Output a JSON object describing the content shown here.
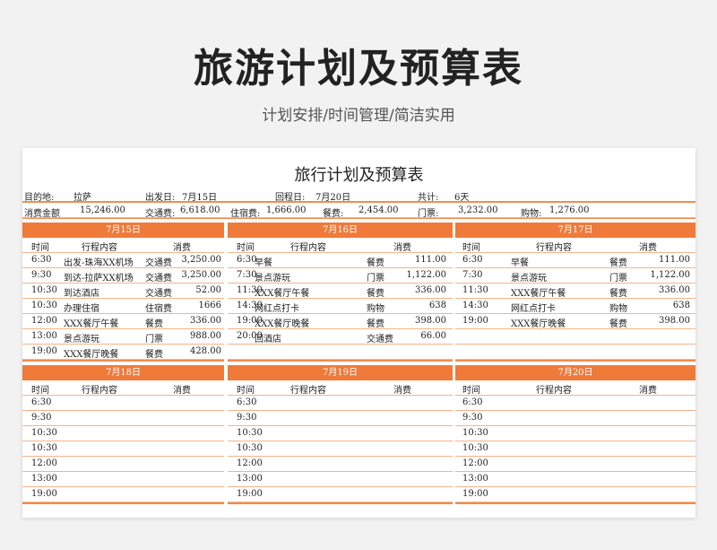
{
  "header": {
    "title": "旅游计划及预算表",
    "subtitle": "计划安排/时间管理/简洁实用"
  },
  "sheet": {
    "title": "旅行计划及预算表",
    "info": {
      "destination_label": "目的地:",
      "destination": "拉萨",
      "depart_label": "出发日:",
      "depart": "7月15日",
      "return_label": "回程日:",
      "return": "7月20日",
      "total_label": "共计:",
      "total": "6天"
    },
    "budget": {
      "total_label": "消费金额",
      "total": "15,246.00",
      "transport_label": "交通费:",
      "transport": "6,618.00",
      "lodging_label": "住宿费:",
      "lodging": "1,666.00",
      "meals_label": "餐费:",
      "meals": "2,454.00",
      "tickets_label": "门票:",
      "tickets": "3,232.00",
      "shopping_label": "购物:",
      "shopping": "1,276.00"
    },
    "columns": {
      "time": "时间",
      "item": "行程内容",
      "cost": "消费"
    },
    "days": [
      {
        "date": "7月15日",
        "rows": [
          {
            "time": "6:30",
            "item": "出发-珠海XX机场",
            "cat": "交通费",
            "amount": "3,250.00"
          },
          {
            "time": "9:30",
            "item": "到达-拉萨XX机场",
            "cat": "交通费",
            "amount": "3,250.00"
          },
          {
            "time": "10:30",
            "item": "到达酒店",
            "cat": "交通费",
            "amount": "52.00"
          },
          {
            "time": "10:30",
            "item": "办理住宿",
            "cat": "住宿费",
            "amount": "1666"
          },
          {
            "time": "12:00",
            "item": "XXX餐厅午餐",
            "cat": "餐费",
            "amount": "336.00"
          },
          {
            "time": "13:00",
            "item": "景点游玩",
            "cat": "门票",
            "amount": "988.00"
          },
          {
            "time": "19:00",
            "item": "XXX餐厅晚餐",
            "cat": "餐费",
            "amount": "428.00"
          }
        ]
      },
      {
        "date": "7月16日",
        "rows": [
          {
            "time": "6:30",
            "item": "早餐",
            "cat": "餐费",
            "amount": "111.00"
          },
          {
            "time": "7:30",
            "item": "景点游玩",
            "cat": "门票",
            "amount": "1,122.00"
          },
          {
            "time": "11:30",
            "item": "XXX餐厅午餐",
            "cat": "餐费",
            "amount": "336.00"
          },
          {
            "time": "14:30",
            "item": "网红点打卡",
            "cat": "购物",
            "amount": "638"
          },
          {
            "time": "19:00",
            "item": "XXX餐厅晚餐",
            "cat": "餐费",
            "amount": "398.00"
          },
          {
            "time": "20:00",
            "item": "回酒店",
            "cat": "交通费",
            "amount": "66.00"
          },
          {
            "time": "",
            "item": "",
            "cat": "",
            "amount": ""
          }
        ]
      },
      {
        "date": "7月17日",
        "rows": [
          {
            "time": "6:30",
            "item": "早餐",
            "cat": "餐费",
            "amount": "111.00"
          },
          {
            "time": "7:30",
            "item": "景点游玩",
            "cat": "门票",
            "amount": "1,122.00"
          },
          {
            "time": "11:30",
            "item": "XXX餐厅午餐",
            "cat": "餐费",
            "amount": "336.00"
          },
          {
            "time": "14:30",
            "item": "网红点打卡",
            "cat": "购物",
            "amount": "638"
          },
          {
            "time": "19:00",
            "item": "XXX餐厅晚餐",
            "cat": "餐费",
            "amount": "398.00"
          },
          {
            "time": "",
            "item": "",
            "cat": "",
            "amount": ""
          },
          {
            "time": "",
            "item": "",
            "cat": "",
            "amount": ""
          }
        ]
      },
      {
        "date": "7月18日",
        "rows": [
          {
            "time": "6:30",
            "item": "",
            "cat": "",
            "amount": ""
          },
          {
            "time": "9:30",
            "item": "",
            "cat": "",
            "amount": ""
          },
          {
            "time": "10:30",
            "item": "",
            "cat": "",
            "amount": ""
          },
          {
            "time": "10:30",
            "item": "",
            "cat": "",
            "amount": ""
          },
          {
            "time": "12:00",
            "item": "",
            "cat": "",
            "amount": ""
          },
          {
            "time": "13:00",
            "item": "",
            "cat": "",
            "amount": ""
          },
          {
            "time": "19:00",
            "item": "",
            "cat": "",
            "amount": ""
          }
        ]
      },
      {
        "date": "7月19日",
        "rows": [
          {
            "time": "6:30",
            "item": "",
            "cat": "",
            "amount": ""
          },
          {
            "time": "9:30",
            "item": "",
            "cat": "",
            "amount": ""
          },
          {
            "time": "10:30",
            "item": "",
            "cat": "",
            "amount": ""
          },
          {
            "time": "10:30",
            "item": "",
            "cat": "",
            "amount": ""
          },
          {
            "time": "12:00",
            "item": "",
            "cat": "",
            "amount": ""
          },
          {
            "time": "13:00",
            "item": "",
            "cat": "",
            "amount": ""
          },
          {
            "time": "19:00",
            "item": "",
            "cat": "",
            "amount": ""
          }
        ]
      },
      {
        "date": "7月20日",
        "rows": [
          {
            "time": "6:30",
            "item": "",
            "cat": "",
            "amount": ""
          },
          {
            "time": "9:30",
            "item": "",
            "cat": "",
            "amount": ""
          },
          {
            "time": "10:30",
            "item": "",
            "cat": "",
            "amount": ""
          },
          {
            "time": "10:30",
            "item": "",
            "cat": "",
            "amount": ""
          },
          {
            "time": "12:00",
            "item": "",
            "cat": "",
            "amount": ""
          },
          {
            "time": "13:00",
            "item": "",
            "cat": "",
            "amount": ""
          },
          {
            "time": "19:00",
            "item": "",
            "cat": "",
            "amount": ""
          }
        ]
      }
    ]
  },
  "colors": {
    "accent": "#f07a3a",
    "rule": "#f5b48a"
  }
}
